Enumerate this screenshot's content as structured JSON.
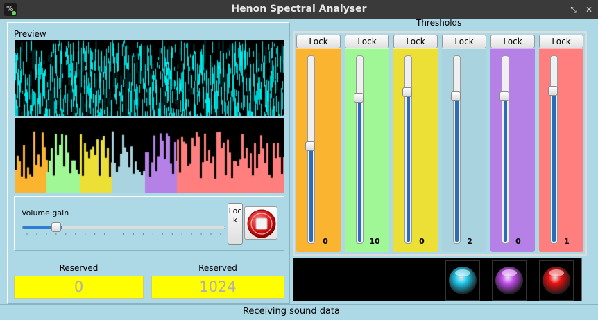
{
  "window": {
    "title": "Henon Spectral Analyser",
    "app_icon_glyph": "%",
    "minimize": "—",
    "maximize": "⤡",
    "close": "✕"
  },
  "preview": {
    "label": "Preview",
    "volume_label": "Volume gain",
    "volume_level": 0.15,
    "lock_label": "Lock"
  },
  "reserved": [
    {
      "label": "Reserved",
      "value": "0"
    },
    {
      "label": "Reserved",
      "value": "1024"
    }
  ],
  "thresholds": {
    "label": "Thresholds",
    "channels": [
      {
        "lock_label": "Lock",
        "color": "#fbb42f",
        "value": "0",
        "level": 0.52
      },
      {
        "lock_label": "Lock",
        "color": "#9ff895",
        "value": "10",
        "level": 0.79
      },
      {
        "lock_label": "Lock",
        "color": "#ece037",
        "value": "0",
        "level": 0.82
      },
      {
        "lock_label": "Lock",
        "color": "#a9d3df",
        "value": "2",
        "level": 0.8
      },
      {
        "lock_label": "Lock",
        "color": "#b581e6",
        "value": "0",
        "level": 0.8
      },
      {
        "lock_label": "Lock",
        "color": "#ff7f7e",
        "value": "1",
        "level": 0.83
      }
    ]
  },
  "indicators": [
    {
      "color": "#1fc9ee"
    },
    {
      "color": "#c44ef0"
    },
    {
      "color": "#ee1111"
    }
  ],
  "status": {
    "text": "Receiving sound data"
  },
  "colors": {
    "background": "#add8e6",
    "waveform": "#00eaea",
    "reserved_field": "#ffff00",
    "slider_fill": "#2b6cb8"
  }
}
